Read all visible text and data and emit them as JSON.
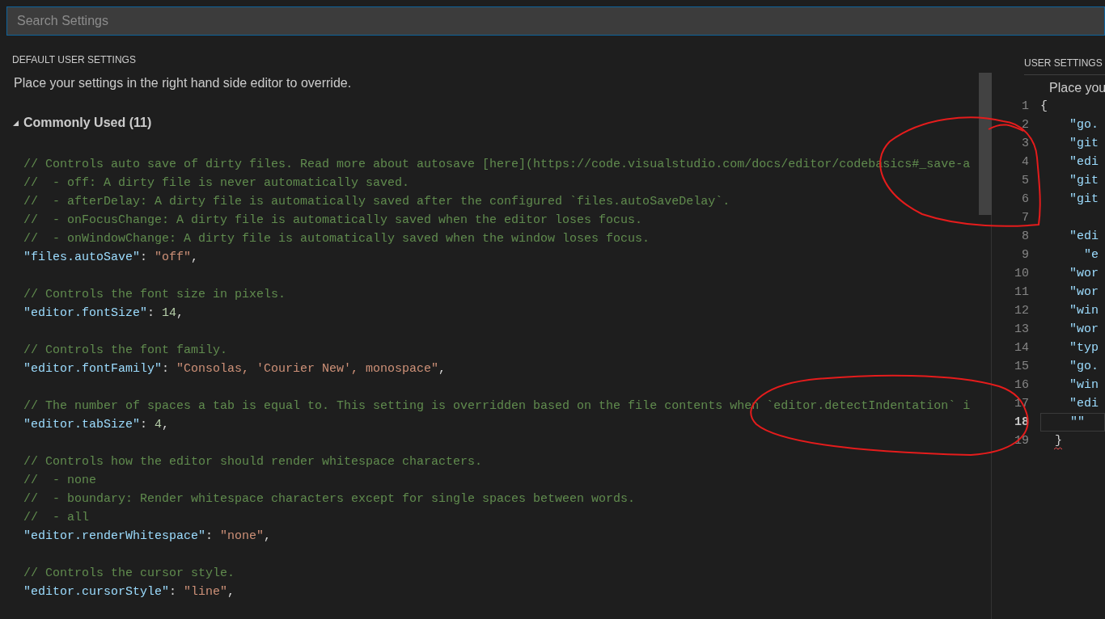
{
  "search": {
    "placeholder": "Search Settings"
  },
  "default_settings": {
    "title": "DEFAULT USER SETTINGS",
    "description": "Place your settings in the right hand side editor to override.",
    "group": {
      "label": "Commonly Used (11)",
      "expanded": true
    },
    "lines": [
      {
        "kind": "code",
        "tokens": [
          {
            "kind": "comment",
            "text": "// Controls auto save of dirty files. Read more about autosave [here](https://code.visualstudio.com/docs/editor/codebasics#_save-a"
          }
        ]
      },
      {
        "kind": "code",
        "tokens": [
          {
            "kind": "comment",
            "text": "//  - off: A dirty file is never automatically saved."
          }
        ]
      },
      {
        "kind": "code",
        "tokens": [
          {
            "kind": "comment",
            "text": "//  - afterDelay: A dirty file is automatically saved after the configured `files.autoSaveDelay`."
          }
        ]
      },
      {
        "kind": "code",
        "tokens": [
          {
            "kind": "comment",
            "text": "//  - onFocusChange: A dirty file is automatically saved when the editor loses focus."
          }
        ]
      },
      {
        "kind": "code",
        "tokens": [
          {
            "kind": "comment",
            "text": "//  - onWindowChange: A dirty file is automatically saved when the window loses focus."
          }
        ]
      },
      {
        "kind": "code",
        "tokens": [
          {
            "kind": "key",
            "text": "\"files.autoSave\""
          },
          {
            "kind": "punct",
            "text": ": "
          },
          {
            "kind": "string",
            "text": "\"off\""
          },
          {
            "kind": "punct",
            "text": ","
          }
        ]
      },
      {
        "kind": "blank"
      },
      {
        "kind": "code",
        "tokens": [
          {
            "kind": "comment",
            "text": "// Controls the font size in pixels."
          }
        ]
      },
      {
        "kind": "code",
        "tokens": [
          {
            "kind": "key",
            "text": "\"editor.fontSize\""
          },
          {
            "kind": "punct",
            "text": ": "
          },
          {
            "kind": "number",
            "text": "14"
          },
          {
            "kind": "punct",
            "text": ","
          }
        ]
      },
      {
        "kind": "blank"
      },
      {
        "kind": "code",
        "tokens": [
          {
            "kind": "comment",
            "text": "// Controls the font family."
          }
        ]
      },
      {
        "kind": "code",
        "tokens": [
          {
            "kind": "key",
            "text": "\"editor.fontFamily\""
          },
          {
            "kind": "punct",
            "text": ": "
          },
          {
            "kind": "string",
            "text": "\"Consolas, 'Courier New', monospace\""
          },
          {
            "kind": "punct",
            "text": ","
          }
        ]
      },
      {
        "kind": "blank"
      },
      {
        "kind": "code",
        "tokens": [
          {
            "kind": "comment",
            "text": "// The number of spaces a tab is equal to. This setting is overridden based on the file contents when `editor.detectIndentation` i"
          }
        ]
      },
      {
        "kind": "code",
        "tokens": [
          {
            "kind": "key",
            "text": "\"editor.tabSize\""
          },
          {
            "kind": "punct",
            "text": ": "
          },
          {
            "kind": "number",
            "text": "4"
          },
          {
            "kind": "punct",
            "text": ","
          }
        ]
      },
      {
        "kind": "blank"
      },
      {
        "kind": "code",
        "tokens": [
          {
            "kind": "comment",
            "text": "// Controls how the editor should render whitespace characters."
          }
        ]
      },
      {
        "kind": "code",
        "tokens": [
          {
            "kind": "comment",
            "text": "//  - none"
          }
        ]
      },
      {
        "kind": "code",
        "tokens": [
          {
            "kind": "comment",
            "text": "//  - boundary: Render whitespace characters except for single spaces between words."
          }
        ]
      },
      {
        "kind": "code",
        "tokens": [
          {
            "kind": "comment",
            "text": "//  - all"
          }
        ]
      },
      {
        "kind": "code",
        "tokens": [
          {
            "kind": "key",
            "text": "\"editor.renderWhitespace\""
          },
          {
            "kind": "punct",
            "text": ": "
          },
          {
            "kind": "string",
            "text": "\"none\""
          },
          {
            "kind": "punct",
            "text": ","
          }
        ]
      },
      {
        "kind": "blank"
      },
      {
        "kind": "code",
        "tokens": [
          {
            "kind": "comment",
            "text": "// Controls the cursor style."
          }
        ]
      },
      {
        "kind": "code",
        "tokens": [
          {
            "kind": "key",
            "text": "\"editor.cursorStyle\""
          },
          {
            "kind": "punct",
            "text": ": "
          },
          {
            "kind": "string",
            "text": "\"line\""
          },
          {
            "kind": "punct",
            "text": ","
          }
        ]
      }
    ]
  },
  "user_settings": {
    "title": "USER SETTINGS",
    "description": "Place you",
    "lines": [
      {
        "number": "1",
        "text": "{",
        "kind": "open",
        "selected": false,
        "error": false
      },
      {
        "number": "2",
        "text": "\"go.",
        "kind": "member",
        "selected": false,
        "error": false
      },
      {
        "number": "3",
        "text": "\"git",
        "kind": "member",
        "selected": false,
        "error": false
      },
      {
        "number": "4",
        "text": "\"edi",
        "kind": "member",
        "selected": false,
        "error": false
      },
      {
        "number": "5",
        "text": "\"git",
        "kind": "member",
        "selected": false,
        "error": false
      },
      {
        "number": "6",
        "text": "\"git",
        "kind": "member",
        "selected": false,
        "error": false
      },
      {
        "number": "7",
        "kind": "empty",
        "selected": false,
        "error": false
      },
      {
        "number": "8",
        "text": "\"edi",
        "kind": "member",
        "selected": false,
        "error": false
      },
      {
        "number": "9",
        "text": "\"e",
        "kind": "nested",
        "selected": false,
        "error": false
      },
      {
        "number": "10",
        "text": "\"wor",
        "kind": "member",
        "selected": false,
        "error": false
      },
      {
        "number": "11",
        "text": "\"wor",
        "kind": "member",
        "selected": false,
        "error": false
      },
      {
        "number": "12",
        "text": "\"win",
        "kind": "member",
        "selected": false,
        "error": false
      },
      {
        "number": "13",
        "text": "\"wor",
        "kind": "member",
        "selected": false,
        "error": false
      },
      {
        "number": "14",
        "text": "\"typ",
        "kind": "member",
        "selected": false,
        "error": false
      },
      {
        "number": "15",
        "text": "\"go.",
        "kind": "member",
        "selected": false,
        "error": false
      },
      {
        "number": "16",
        "text": "\"win",
        "kind": "member",
        "selected": false,
        "error": false
      },
      {
        "number": "17",
        "text": "\"edi",
        "kind": "member",
        "selected": false,
        "error": false
      },
      {
        "number": "18",
        "text": "\"\"",
        "kind": "member",
        "selected": true,
        "error": false
      },
      {
        "number": "19",
        "text": "}",
        "kind": "close",
        "selected": false,
        "error": true
      }
    ]
  }
}
